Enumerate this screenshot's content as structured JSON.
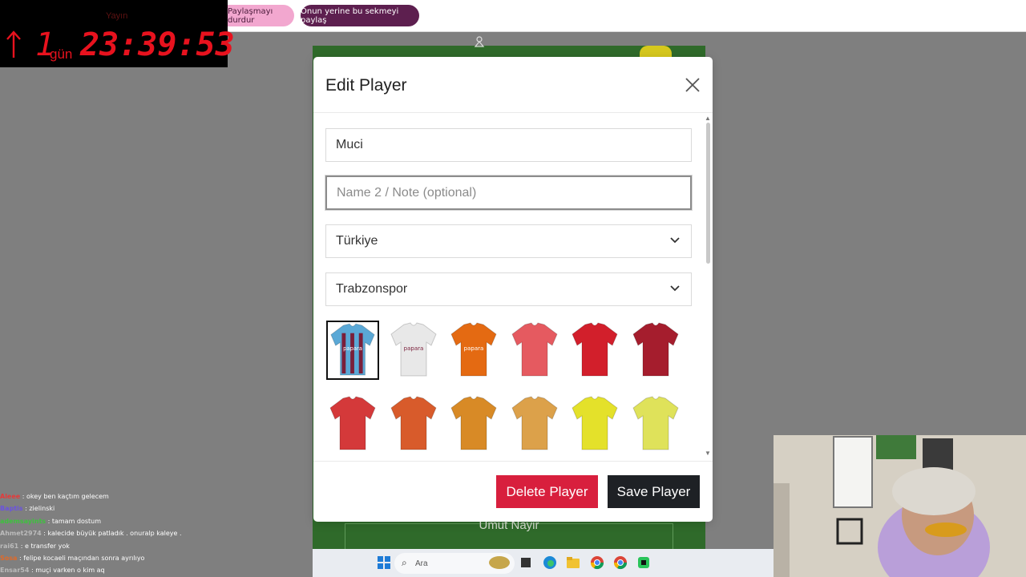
{
  "timer": {
    "label": "Yayın",
    "days": "1",
    "days_unit": "gün",
    "time": "23:39:53"
  },
  "share_bar": {
    "stop_label": "Paylaşmayı durdur",
    "switch_label": "Onun yerine bu sekmeyi paylaş"
  },
  "modal": {
    "title": "Edit Player",
    "name_value": "Muci",
    "note_placeholder": "Name 2 / Note (optional)",
    "nationality": "Türkiye",
    "club": "Trabzonspor",
    "delete_label": "Delete Player",
    "save_label": "Save Player",
    "kits": [
      {
        "name": "home",
        "color": "#5aa8d6",
        "color2": "#7a1f3a",
        "sponsor": "papara"
      },
      {
        "name": "white",
        "color": "#e8e8e8",
        "color2": "#c0c0c0",
        "sponsor": "papara"
      },
      {
        "name": "orange",
        "color": "#e46a12",
        "color2": "#2a2a2a",
        "sponsor": "papara"
      },
      {
        "name": "coral",
        "color": "#e55a60",
        "color2": "#e55a60",
        "sponsor": ""
      },
      {
        "name": "red",
        "color": "#d21f2b",
        "color2": "#d21f2b",
        "sponsor": ""
      },
      {
        "name": "maroon",
        "color": "#a51d2d",
        "color2": "#a51d2d",
        "sponsor": ""
      },
      {
        "name": "red-2",
        "color": "#d4393a",
        "color2": "#d4393a",
        "sponsor": ""
      },
      {
        "name": "burnt-orange",
        "color": "#d85b2b",
        "color2": "#d85b2b",
        "sponsor": ""
      },
      {
        "name": "dark-gold",
        "color": "#d88a26",
        "color2": "#d88a26",
        "sponsor": ""
      },
      {
        "name": "gold",
        "color": "#dca14a",
        "color2": "#dca14a",
        "sponsor": ""
      },
      {
        "name": "yellow",
        "color": "#e4e12a",
        "color2": "#e4e12a",
        "sponsor": ""
      },
      {
        "name": "light-yellow",
        "color": "#dfe25a",
        "color2": "#dfe25a",
        "sponsor": ""
      }
    ]
  },
  "pitch": {
    "player_label": "Umut Nayir"
  },
  "chat": [
    {
      "user": "Aleee",
      "color": "#e63a3a",
      "text": ": okey ben kaçtım gelecem"
    },
    {
      "user": "Baptis",
      "color": "#6a52e0",
      "text": ": zielinski"
    },
    {
      "user": "ademsayints",
      "color": "#3cc43c",
      "text": ": tamam dostum"
    },
    {
      "user": "Ahmet2974",
      "color": "#bbbbbb",
      "text": ": kalecide büyük patladık . onuralp kaleye ."
    },
    {
      "user": "rai61",
      "color": "#bbbbbb",
      "text": ": e transfer yok"
    },
    {
      "user": "Sosa",
      "color": "#e06a2a",
      "text": ": felipe kocaeli maçından sonra ayrılıyo"
    },
    {
      "user": "Ensar54",
      "color": "#bbbbbb",
      "text": ": muçi varken o kim aq"
    }
  ],
  "taskbar": {
    "search_placeholder": "Ara"
  },
  "colors": {
    "delete": "#d81f3d",
    "save": "#1e2125",
    "share_stop": "#f2a7cf",
    "share_switch": "#5d1f4f",
    "timer": "#e8121e"
  }
}
